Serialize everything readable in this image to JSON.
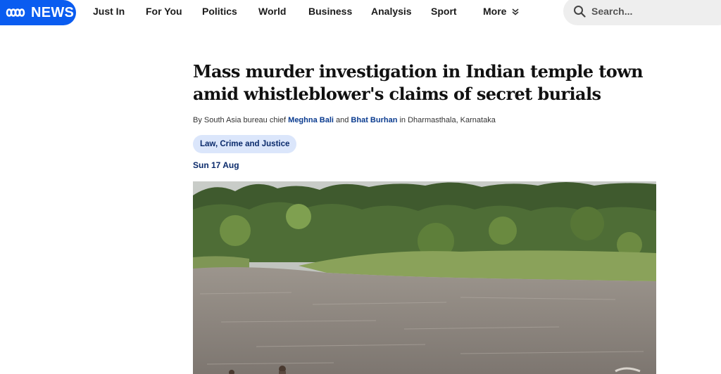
{
  "brand": {
    "logo_text": "NEWS",
    "color": "#0a5cf0"
  },
  "nav": {
    "items": [
      "Just In",
      "For You",
      "Politics",
      "World",
      "Business",
      "Analysis",
      "Sport",
      "More"
    ]
  },
  "search": {
    "placeholder": "Search..."
  },
  "article": {
    "headline": "Mass murder investigation in Indian temple town amid whistleblower's claims of secret burials",
    "byline": {
      "prefix": "By South Asia bureau chief ",
      "author1": "Meghna Bali",
      "joiner": " and ",
      "author2": "Bhat Burhan",
      "suffix": " in Dharmasthala, Karnataka"
    },
    "tag": "Law, Crime and Justice",
    "date": "Sun 17 Aug"
  },
  "icons": [
    "abc-logo-icon",
    "chevron-down-icon",
    "search-icon"
  ]
}
